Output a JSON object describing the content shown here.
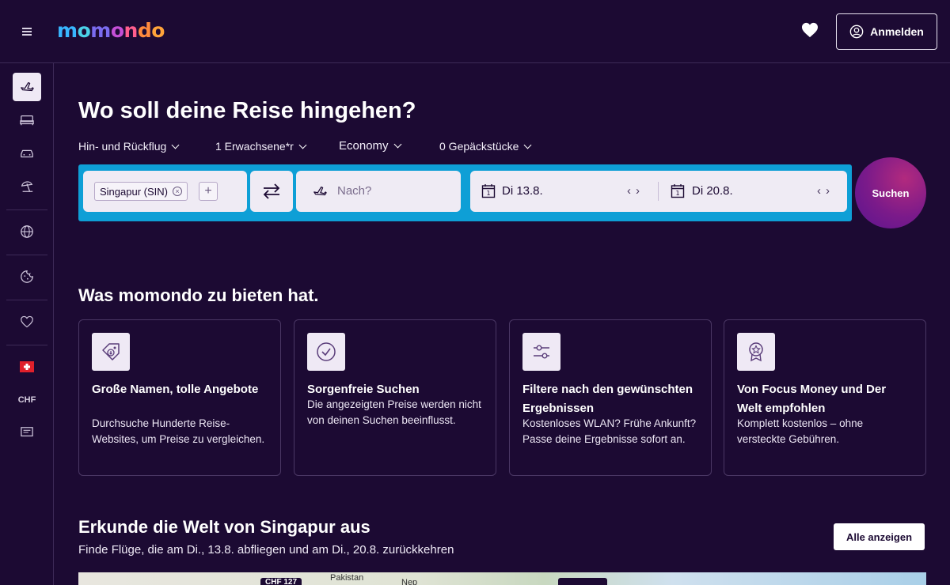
{
  "header": {
    "logo": [
      "m",
      "o",
      "m",
      "o",
      "n",
      "d",
      "o"
    ],
    "login_label": "Anmelden"
  },
  "sidebar": {
    "items": [
      {
        "name": "flights",
        "icon": "plane-icon"
      },
      {
        "name": "hotels",
        "icon": "bed-icon"
      },
      {
        "name": "cars",
        "icon": "car-icon"
      },
      {
        "name": "packages",
        "icon": "beach-umbrella-icon"
      },
      {
        "name": "explore",
        "icon": "globe-icon"
      },
      {
        "name": "trips",
        "icon": "cookie-icon"
      },
      {
        "name": "saved",
        "icon": "heart-icon"
      },
      {
        "name": "country",
        "icon": "swiss-flag-icon"
      },
      {
        "name": "feedback",
        "icon": "message-icon"
      }
    ],
    "currency": "CHF"
  },
  "hero": {
    "title": "Wo soll deine Reise hingehen?",
    "options": {
      "trip_type": "Hin- und Rückflug",
      "travellers": "1 Erwachsene*r",
      "cabin": "Economy",
      "bags": "0 Gepäckstücke"
    }
  },
  "search": {
    "origin_chip": "Singapur (SIN)",
    "add_label": "+",
    "destination_placeholder": "Nach?",
    "depart_date": "Di 13.8.",
    "return_date": "Di 20.8.",
    "cal_day": "1",
    "submit_label": "Suchen"
  },
  "features": {
    "title": "Was momondo zu bieten hat.",
    "cards": [
      {
        "icon": "price-tag-icon",
        "title": "Große Namen, tolle Angebote",
        "text": "Durchsuche Hunderte Reise-Websites, um Preise zu vergleichen."
      },
      {
        "icon": "check-circle-icon",
        "title": "Sorgenfreie Suchen",
        "text": "Die angezeigten Preise werden nicht von deinen Suchen beeinflusst."
      },
      {
        "icon": "sliders-icon",
        "title": "Filtere nach den gewünschten Ergebnissen",
        "text": "Kostenloses WLAN? Frühe Ankunft? Passe deine Ergebnisse sofort an."
      },
      {
        "icon": "award-icon",
        "title": "Von Focus Money und Der Welt empfohlen",
        "text": "Komplett kostenlos – ohne versteckte Gebühren."
      }
    ]
  },
  "explore": {
    "title": "Erkunde die Welt von Singapur aus",
    "subtitle": "Finde Flüge, die am Di., 13.8. abfliegen und am Di., 20.8. zurückkehren",
    "all_label": "Alle anzeigen",
    "map_labels": [
      "Pakistan",
      "Nep"
    ],
    "price_pill": "CHF 127"
  }
}
